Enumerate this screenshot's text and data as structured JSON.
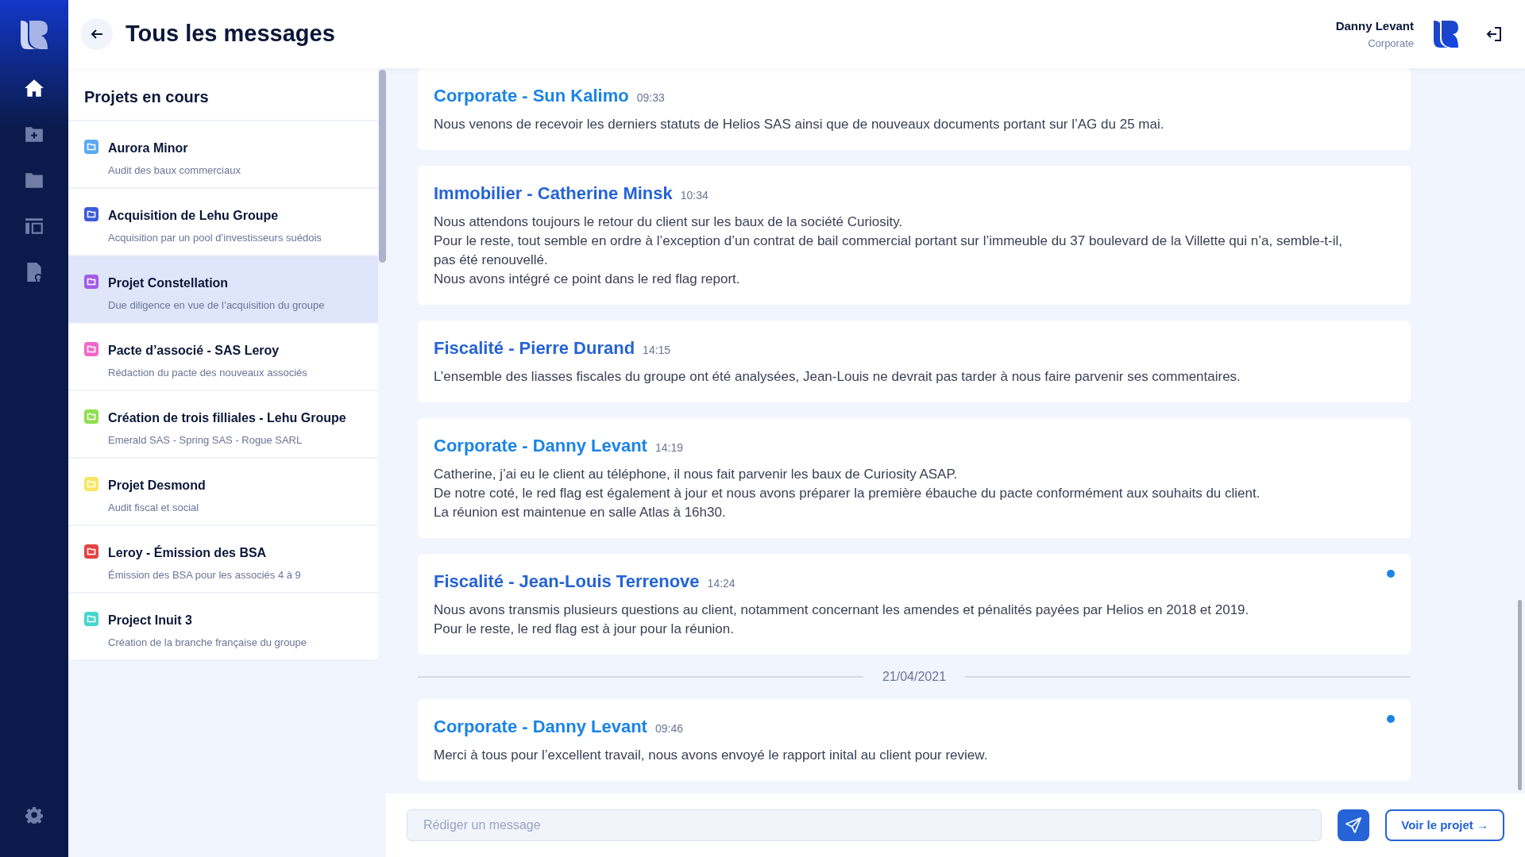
{
  "header": {
    "title": "Tous les messages",
    "user": {
      "name": "Danny Levant",
      "team": "Corporate"
    }
  },
  "nav": [
    {
      "kind": "home",
      "selected": true
    },
    {
      "kind": "folder-plus",
      "selected": false
    },
    {
      "kind": "folder",
      "selected": false
    },
    {
      "kind": "layout",
      "selected": false
    },
    {
      "kind": "document",
      "selected": false
    }
  ],
  "projects": {
    "title": "Projets en cours",
    "items": [
      {
        "name": "Aurora Minor",
        "description": "Audit des baux commerciaux",
        "color": "#5aa9f5",
        "selected": false
      },
      {
        "name": "Acquisition de Lehu Groupe",
        "description": "Acquisition par un pool d’investisseurs suédois",
        "color": "#3b5bdb",
        "selected": false
      },
      {
        "name": "Projet Constellation",
        "description": "Due diligence en vue de l’acquisition du groupe",
        "color": "#a35ce8",
        "selected": true
      },
      {
        "name": "Pacte d’associé - SAS Leroy",
        "description": "Rédaction du pacte des nouveaux associés",
        "color": "#f06ac8",
        "selected": false
      },
      {
        "name": "Création de trois filliales - Lehu Groupe",
        "description": "Emerald SAS - Spring SAS - Rogue SARL",
        "color": "#8ee04f",
        "selected": false
      },
      {
        "name": "Projet Desmond",
        "description": "Audit fiscal et social",
        "color": "#f7e663",
        "selected": false
      },
      {
        "name": "Leroy - Émission des BSA",
        "description": "Émission des BSA pour les associés 4 à 9",
        "color": "#e34444",
        "selected": false
      },
      {
        "name": "Project Inuit 3",
        "description": "Création de la branche française du groupe",
        "color": "#45d6cf",
        "selected": false
      }
    ]
  },
  "messages": [
    {
      "kind": "message",
      "author": "Corporate - Sun Kalimo",
      "time": "09:33",
      "color": "#1a84e6",
      "unread": false,
      "lines": [
        "Nous venons de recevoir les derniers statuts de Helios SAS ainsi que de nouveaux documents portant sur l’AG du 25 mai."
      ]
    },
    {
      "kind": "message",
      "author": "Immobilier - Catherine Minsk",
      "time": "10:34",
      "color": "#2563d6",
      "unread": false,
      "lines": [
        "Nous attendons toujours le retour du client sur les baux de la société Curiosity.",
        "Pour le reste, tout semble en ordre à l’exception d’un contrat de bail commercial portant sur l’immeuble du 37 boulevard de la Villette qui n’a, semble-t-il, pas été renouvellé.",
        "Nous avons intégré ce point dans le red flag report."
      ]
    },
    {
      "kind": "message",
      "author": "Fiscalité - Pierre Durand",
      "time": "14:15",
      "color": "#2563d6",
      "unread": false,
      "lines": [
        "L’ensemble des liasses fiscales du groupe ont été analysées, Jean-Louis ne devrait pas tarder à nous faire parvenir ses commentaires."
      ]
    },
    {
      "kind": "message",
      "author": "Corporate - Danny Levant",
      "time": "14:19",
      "color": "#1a84e6",
      "unread": false,
      "lines": [
        "Catherine, j’ai eu le client au téléphone, il nous fait parvenir les baux de Curiosity ASAP.",
        "De notre coté, le red flag est également à jour et nous avons préparer la première ébauche du pacte conformément aux souhaits du client.",
        "La réunion est maintenue en salle Atlas à 16h30."
      ]
    },
    {
      "kind": "message",
      "author": "Fiscalité - Jean-Louis Terrenove",
      "time": "14:24",
      "color": "#2563d6",
      "unread": true,
      "lines": [
        "Nous avons transmis plusieurs questions au client, notamment concernant les amendes et pénalités payées par Helios en 2018 et 2019.",
        "Pour le reste, le red flag est à jour pour la réunion."
      ]
    },
    {
      "kind": "date",
      "label": "21/04/2021"
    },
    {
      "kind": "message",
      "author": "Corporate - Danny Levant",
      "time": "09:46",
      "color": "#1a84e6",
      "unread": true,
      "lines": [
        "Merci à tous pour l’excellent travail, nous avons envoyé le rapport inital au client pour review."
      ]
    }
  ],
  "composer": {
    "placeholder": "Rédiger un message",
    "project_button": "Voir le projet →"
  }
}
